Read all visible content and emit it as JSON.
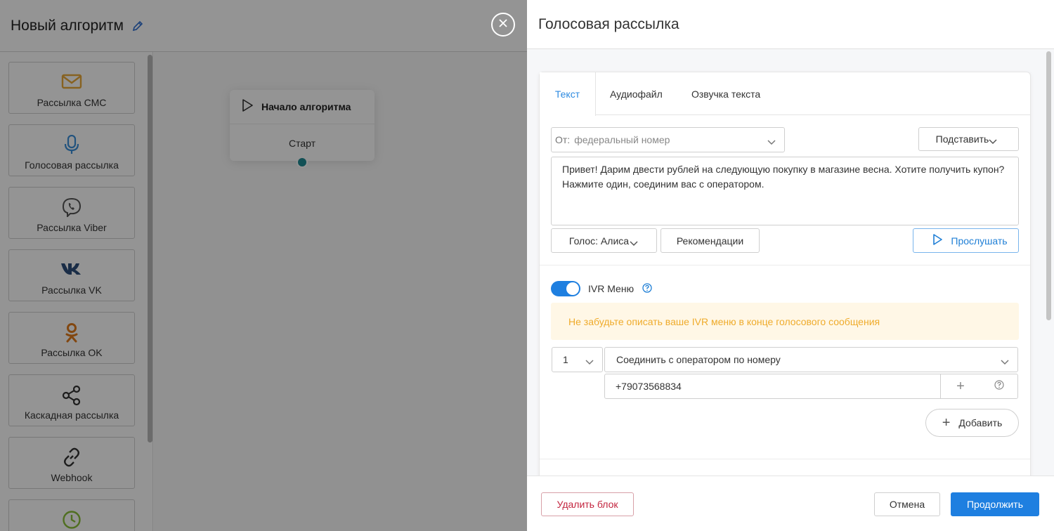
{
  "editor": {
    "title": "Новый алгоритм",
    "blocks": [
      {
        "label": "Рассылка СМС",
        "icon": "mail-icon",
        "color": "#e9a93a"
      },
      {
        "label": "Голосовая рассылка",
        "icon": "microphone-icon",
        "color": "#3b8fd9"
      },
      {
        "label": "Рассылка Viber",
        "icon": "viber-icon",
        "color": "#555555"
      },
      {
        "label": "Рассылка VK",
        "icon": "vk-icon",
        "color": "#2d4f7a"
      },
      {
        "label": "Рассылка OK",
        "icon": "ok-icon",
        "color": "#e07b1c"
      },
      {
        "label": "Каскадная рассылка",
        "icon": "share-icon",
        "color": "#333333"
      },
      {
        "label": "Webhook",
        "icon": "link-icon",
        "color": "#333333"
      },
      {
        "label": "",
        "icon": "clock-icon",
        "color": "#8bbf3a"
      }
    ],
    "start_node": {
      "title": "Начало алгоритма",
      "start_label": "Старт"
    }
  },
  "panel": {
    "title": "Голосовая рассылка",
    "tabs": [
      "Текст",
      "Аудиофайл",
      "Озвучка текста"
    ],
    "active_tab": "Текст",
    "from": {
      "label": "От:",
      "value": "федеральный номер"
    },
    "substitute_label": "Подставить",
    "message": "Привет! Дарим двести рублей на следующую покупку в магазине весна. Хотите получить купон? Нажмите один, соединим вас с оператором.",
    "voice_label": "Голос: Алиса",
    "recommendations_label": "Рекомендации",
    "listen_label": "Прослушать",
    "ivr": {
      "enabled": true,
      "label": "IVR Меню",
      "warning": "Не забудьте описать ваше IVR меню в конце голосового сообщения",
      "key": "1",
      "action": "Соединить с оператором по номеру",
      "phone": "+79073568834",
      "add_label": "Добавить"
    },
    "footer": {
      "delete_label": "Удалить блок",
      "cancel_label": "Отмена",
      "continue_label": "Продолжить"
    }
  },
  "colors": {
    "accent": "#1e7fe0",
    "warning_text": "#efab2b",
    "danger": "#c3243e",
    "node_dot": "#1f8a93"
  }
}
